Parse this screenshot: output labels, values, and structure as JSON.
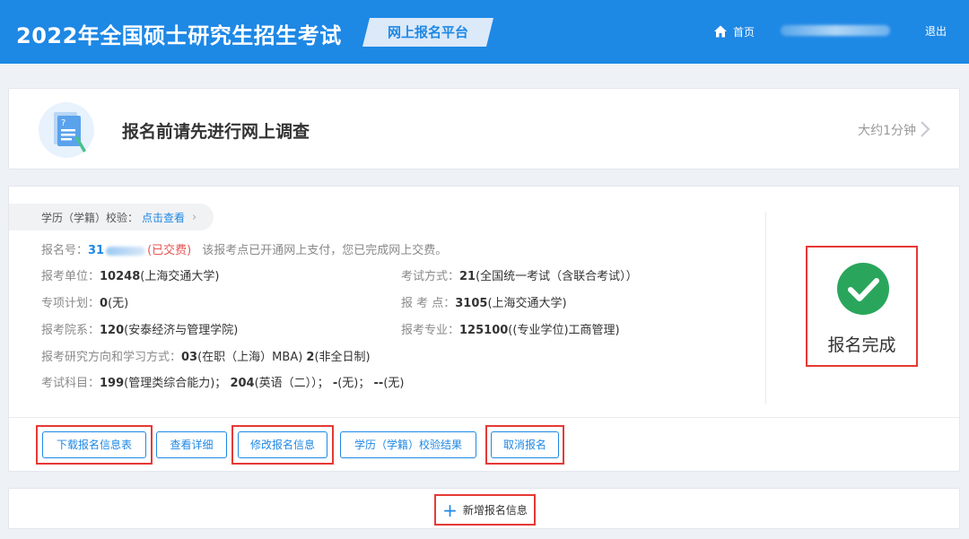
{
  "header": {
    "site_title": "2022年全国硕士研究生招生考试",
    "platform_label": "网上报名平台",
    "nav": {
      "home_label": "首页",
      "logout_label": "退出"
    },
    "brand_color": "#1e88e5"
  },
  "survey": {
    "title": "报名前请先进行网上调查",
    "time_label": "大约1分钟",
    "icon": "survey-document-icon"
  },
  "registration": {
    "verify": {
      "label": "学历（学籍）校验：",
      "link_label": "点击查看"
    },
    "reg_no": {
      "label": "报名号：",
      "value_prefix": "31",
      "status": "(已交费)",
      "note": "该报考点已开通网上支付，您已完成网上交费。"
    },
    "fields": {
      "unit": {
        "label": "报考单位：",
        "code": "10248",
        "name": "(上海交通大学)"
      },
      "exam_mode": {
        "label": "考试方式：",
        "code": "21",
        "name": "(全国统一考试（含联合考试））"
      },
      "special_plan": {
        "label": "专项计划：",
        "code": "0",
        "name": "(无)"
      },
      "exam_site": {
        "label": "报 考 点：",
        "code": "3105",
        "name": "(上海交通大学)"
      },
      "department": {
        "label": "报考院系：",
        "code": "120",
        "name": "(安泰经济与管理学院)"
      },
      "major": {
        "label": "报考专业：",
        "code": "125100",
        "name": "((专业学位)工商管理)"
      },
      "direction": {
        "label": "报考研究方向和学习方式：",
        "code": "03",
        "name": "(在职（上海）MBA)",
        "mode_code": "2",
        "mode_name": "(非全日制)"
      },
      "subjects": {
        "label": "考试科目：",
        "s1_code": "199",
        "s1_name": "(管理类综合能力)；",
        "s2_code": "204",
        "s2_name": "(英语（二））；",
        "s3_code": "-",
        "s3_name": "(无)；",
        "s4_code": "--",
        "s4_name": "(无)"
      }
    },
    "status_label": "报名完成",
    "status_color": "#2aa65c",
    "buttons": {
      "download": "下载报名信息表",
      "details": "查看详细",
      "modify": "修改报名信息",
      "verify_result": "学历（学籍）校验结果",
      "cancel": "取消报名"
    },
    "highlight_color": "#e53935"
  },
  "add": {
    "label": "新增报名信息"
  }
}
